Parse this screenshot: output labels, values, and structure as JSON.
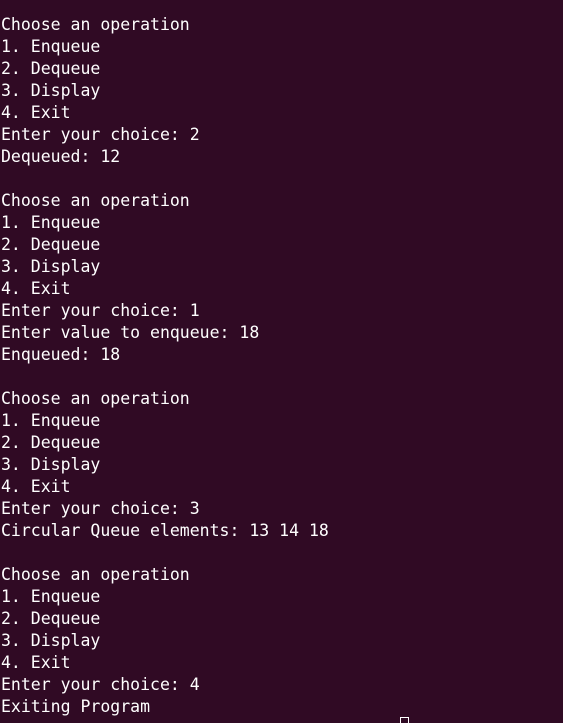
{
  "terminal": {
    "background": "#300a24",
    "foreground": "#ffffff",
    "lines": [
      "Choose an operation",
      "1. Enqueue",
      "2. Dequeue",
      "3. Display",
      "4. Exit",
      "Enter your choice: 2",
      "Dequeued: 12",
      "",
      "Choose an operation",
      "1. Enqueue",
      "2. Dequeue",
      "3. Display",
      "4. Exit",
      "Enter your choice: 1",
      "Enter value to enqueue: 18",
      "Enqueued: 18",
      "",
      "Choose an operation",
      "1. Enqueue",
      "2. Dequeue",
      "3. Display",
      "4. Exit",
      "Enter your choice: 3",
      "Circular Queue elements: 13 14 18",
      "",
      "Choose an operation",
      "1. Enqueue",
      "2. Dequeue",
      "3. Display",
      "4. Exit",
      "Enter your choice: 4",
      "Exiting Program"
    ],
    "cursor_icon": "block-cursor-icon"
  }
}
